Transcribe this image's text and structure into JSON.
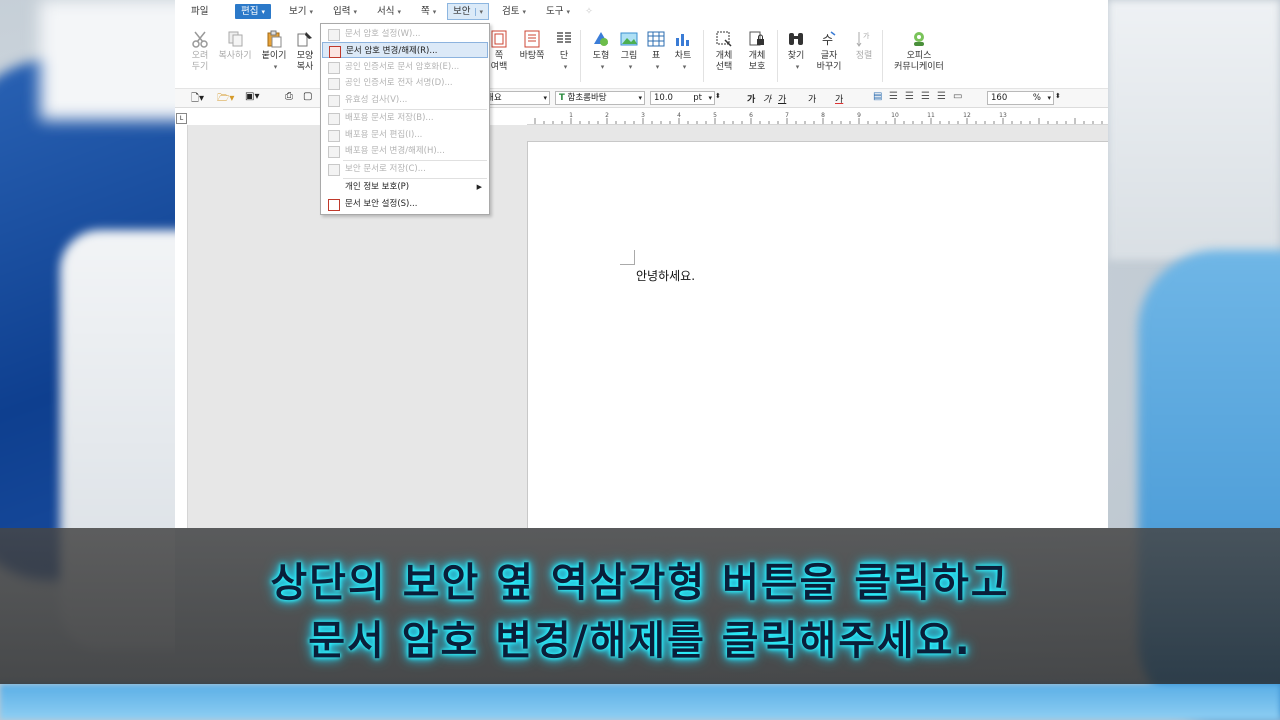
{
  "menubar": {
    "items": [
      {
        "label": "파일"
      },
      {
        "label": "편집"
      },
      {
        "label": "보기"
      },
      {
        "label": "입력"
      },
      {
        "label": "서식"
      },
      {
        "label": "쪽"
      },
      {
        "label": "보안"
      },
      {
        "label": "검토"
      },
      {
        "label": "도구"
      }
    ]
  },
  "ribbon": {
    "cut": "오려\n두기",
    "copy": "복사하기",
    "paste": "붙이기",
    "format_copy": "모양\n복사",
    "page_margin": "쪽\n여백",
    "background": "바탕쪽",
    "column": "단",
    "shape": "도형",
    "picture": "그림",
    "table": "표",
    "chart": "차트",
    "object_select": "개체\n선택",
    "object_protect": "개체\n보호",
    "find": "찾기",
    "replace": "글자\n바꾸기",
    "sort": "정렬",
    "office_community": "오피스\n커뮤니케이터"
  },
  "toolbar2": {
    "style": "개요",
    "font": "함초롬바탕",
    "font_size": "10.0",
    "size_unit": "pt",
    "bold": "가",
    "italic": "가",
    "underline": "가",
    "strike": "가",
    "color": "가",
    "zoom": "160",
    "zoom_unit": "%"
  },
  "security_menu": {
    "items": [
      {
        "label": "문서 암호 설정(W)...",
        "enabled": false
      },
      {
        "label": "문서 암호 변경/해제(R)...",
        "enabled": true,
        "highlighted": true
      },
      {
        "label": "공인 인증서로 문서 암호화(E)...",
        "enabled": false
      },
      {
        "label": "공인 인증서로 전자 서명(D)...",
        "enabled": false
      },
      {
        "label": "유효성 검사(V)...",
        "enabled": false
      },
      {
        "label": "배포용 문서로 저장(B)...",
        "enabled": false
      },
      {
        "label": "배포용 문서 편집(I)...",
        "enabled": false
      },
      {
        "label": "배포용 문서 변경/해제(H)...",
        "enabled": false
      },
      {
        "label": "보안 문서로 저장(C)...",
        "enabled": false
      },
      {
        "label": "개인 정보 보호(P)",
        "enabled": true,
        "submenu": true
      },
      {
        "label": "문서 보안 설정(S)...",
        "enabled": true
      }
    ]
  },
  "document": {
    "text": "안녕하세요."
  },
  "ruler_ticks": [
    "1",
    "2",
    "3",
    "4",
    "5",
    "6",
    "7",
    "8",
    "9",
    "10",
    "11",
    "12",
    "13"
  ],
  "subtitle": {
    "line1": "상단의 보안 옆 역삼각형 버튼을 클릭하고",
    "line2": "문서 암호 변경/해제를 클릭해주세요."
  },
  "colors": {
    "menu_active": "#2b79c9",
    "highlight": "#dce9f7",
    "subtitle_glow": "#2ff6ff"
  }
}
